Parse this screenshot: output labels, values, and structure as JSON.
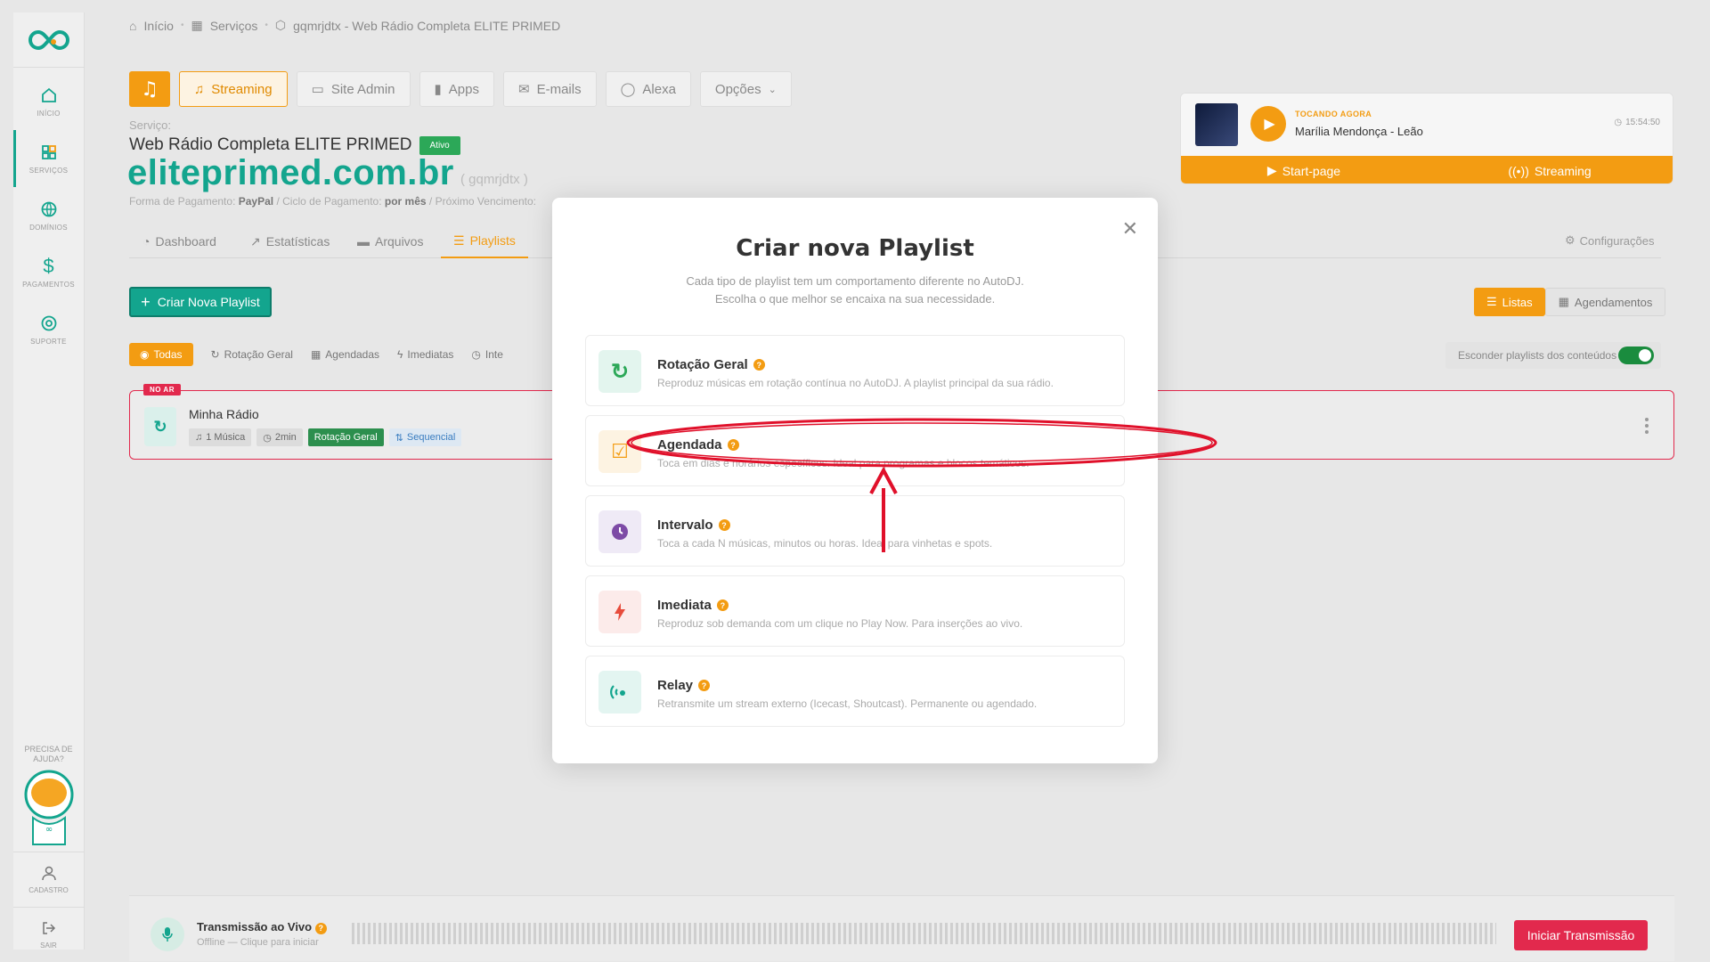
{
  "breadcrumb": {
    "home": "Início",
    "services": "Serviços",
    "current": "gqmrjdtx - Web Rádio Completa ELITE PRIMED"
  },
  "sidebar": {
    "items": [
      {
        "label": "INÍCIO"
      },
      {
        "label": "SERVIÇOS"
      },
      {
        "label": "DOMÍNIOS"
      },
      {
        "label": "PAGAMENTOS"
      },
      {
        "label": "SUPORTE"
      }
    ],
    "help": "PRECISA DE AJUDA?",
    "account": "CADASTRO",
    "logout": "SAIR"
  },
  "service_tabs": [
    {
      "label": "Streaming"
    },
    {
      "label": "Site Admin"
    },
    {
      "label": "Apps"
    },
    {
      "label": "E-mails"
    },
    {
      "label": "Alexa"
    },
    {
      "label": "Opções"
    }
  ],
  "service": {
    "label": "Serviço:",
    "name": "Web Rádio Completa ELITE PRIMED",
    "status": "Ativo",
    "domain": "eliteprimed.com.br",
    "code": "( gqmrjdtx )",
    "payment_prefix": "Forma de Pagamento:",
    "payment_method": "PayPal",
    "cycle_prefix": "/ Ciclo de Pagamento:",
    "cycle": "por mês",
    "next_prefix": "/ Próximo Vencimento:"
  },
  "content_tabs": [
    {
      "label": "Dashboard"
    },
    {
      "label": "Estatísticas"
    },
    {
      "label": "Arquivos"
    },
    {
      "label": "Playlists"
    }
  ],
  "settings_label": "Configurações",
  "create_button": "Criar Nova Playlist",
  "view_toggle": {
    "lists": "Listas",
    "schedules": "Agendamentos"
  },
  "filters": [
    {
      "label": "Todas"
    },
    {
      "label": "Rotação Geral"
    },
    {
      "label": "Agendadas"
    },
    {
      "label": "Imediatas"
    },
    {
      "label": "Inte"
    }
  ],
  "hide_toggle": "Esconder playlists dos conteúdos",
  "playlist": {
    "badge": "NO AR",
    "title": "Minha Rádio",
    "songs": "1 Música",
    "duration": "2min",
    "type": "Rotação Geral",
    "order": "Sequencial"
  },
  "player": {
    "label": "TOCANDO AGORA",
    "song": "Marília Mendonça - Leão",
    "time": "15:54:50",
    "start": "Start-page",
    "streaming": "Streaming"
  },
  "live": {
    "title": "Transmissão ao Vivo",
    "sub": "Offline — Clique para iniciar",
    "button": "Iniciar Transmissão"
  },
  "modal": {
    "title": "Criar nova Playlist",
    "sub1": "Cada tipo de playlist tem um comportamento diferente no AutoDJ.",
    "sub2": "Escolha o que melhor se encaixa na sua necessidade.",
    "options": [
      {
        "title": "Rotação Geral",
        "desc": "Reproduz músicas em rotação contínua no AutoDJ. A playlist principal da sua rádio."
      },
      {
        "title": "Agendada",
        "desc": "Toca em dias e horários específicos. Ideal para programas e blocos temáticos."
      },
      {
        "title": "Intervalo",
        "desc": "Toca a cada N músicas, minutos ou horas. Ideal para vinhetas e spots."
      },
      {
        "title": "Imediata",
        "desc": "Reproduz sob demanda com um clique no Play Now. Para inserções ao vivo."
      },
      {
        "title": "Relay",
        "desc": "Retransmite um stream externo (Icecast, Shoutcast). Permanente ou agendado."
      }
    ]
  },
  "colors": {
    "brand": "#13a58e",
    "accent": "#f39c12",
    "danger": "#e2294d"
  }
}
